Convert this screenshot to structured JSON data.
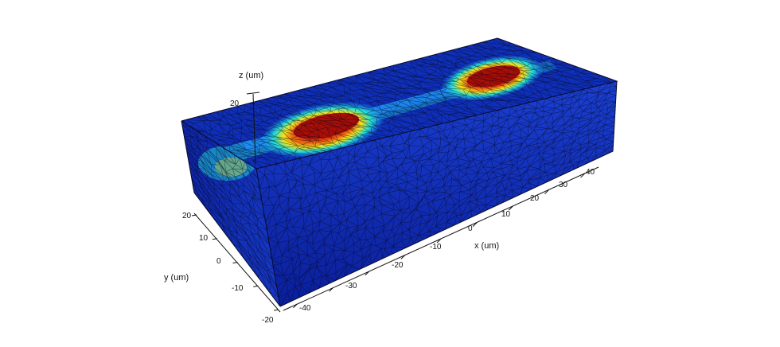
{
  "plot": {
    "x_axis": {
      "label": "x (um)",
      "ticks": [
        "-40",
        "-30",
        "-20",
        "-10",
        "0",
        "10",
        "20",
        "30",
        "40"
      ]
    },
    "y_axis": {
      "label": "y (um)",
      "ticks": [
        "20",
        "10",
        "0",
        "-10",
        "-20"
      ]
    },
    "z_axis": {
      "label": "z (um)",
      "ticks": [
        "20"
      ]
    }
  },
  "colors": {
    "field_low": "#0a1e9a",
    "field_mid": "#1f8fff",
    "field_cyan": "#22e0d8",
    "field_yellow": "#f4e21c",
    "field_orange": "#f06a10",
    "field_high": "#a80e08",
    "mesh": "#050818"
  }
}
